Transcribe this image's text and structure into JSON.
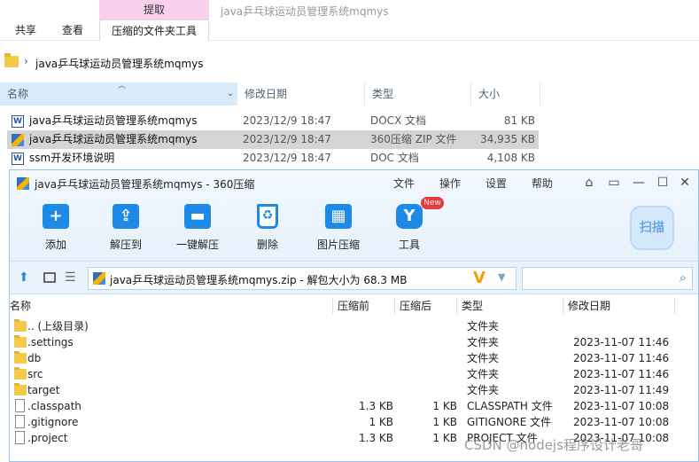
{
  "explorer": {
    "context_tab_header": "提取",
    "context_tab": "压缩的文件夹工具",
    "window_title": "java乒乓球运动员管理系统mqmys",
    "ribbon_tabs": [
      "共享",
      "查看"
    ],
    "address_path": "java乒乓球运动员管理系统mqmys",
    "columns": [
      "名称",
      "修改日期",
      "类型",
      "大小"
    ],
    "files": [
      {
        "name": "java乒乓球运动员管理系统mqmys",
        "date": "2023/12/9 18:47",
        "type": "DOCX 文档",
        "size": "81 KB",
        "icon": "word-doc-icon",
        "selected": false
      },
      {
        "name": "java乒乓球运动员管理系统mqmys",
        "date": "2023/12/9 18:47",
        "type": "360压缩 ZIP 文件",
        "size": "34,935 KB",
        "icon": "zip-archive-icon",
        "selected": true
      },
      {
        "name": "ssm开发环境说明",
        "date": "2023/12/9 18:47",
        "type": "DOC 文档",
        "size": "4,108 KB",
        "icon": "word-doc-icon",
        "selected": false
      }
    ]
  },
  "zip": {
    "title": "java乒乓球运动员管理系统mqmys - 360压缩",
    "menu": [
      "文件",
      "操作",
      "设置",
      "帮助"
    ],
    "toolbar": [
      {
        "label": "添加",
        "icon": "add-icon"
      },
      {
        "label": "解压到",
        "icon": "extract-to-icon"
      },
      {
        "label": "一键解压",
        "icon": "one-click-extract-icon"
      },
      {
        "label": "删除",
        "icon": "delete-icon"
      },
      {
        "label": "图片压缩",
        "icon": "image-compress-icon"
      },
      {
        "label": "工具",
        "icon": "tools-icon"
      }
    ],
    "new_badge": "New",
    "scan_label": "扫描",
    "path_text": "java乒乓球运动员管理系统mqmys.zip - 解包大小为 68.3 MB",
    "path_badge": "V",
    "columns": [
      "名称",
      "压缩前",
      "压缩后",
      "类型",
      "修改日期"
    ],
    "rows": [
      {
        "name": ".. (上级目录)",
        "before": "",
        "after": "",
        "type": "文件夹",
        "modified": "",
        "kind": "folder"
      },
      {
        "name": ".settings",
        "before": "",
        "after": "",
        "type": "文件夹",
        "modified": "2023-11-07 11:46",
        "kind": "folder"
      },
      {
        "name": "db",
        "before": "",
        "after": "",
        "type": "文件夹",
        "modified": "2023-11-07 11:46",
        "kind": "folder"
      },
      {
        "name": "src",
        "before": "",
        "after": "",
        "type": "文件夹",
        "modified": "2023-11-07 11:46",
        "kind": "folder"
      },
      {
        "name": "target",
        "before": "",
        "after": "",
        "type": "文件夹",
        "modified": "2023-11-07 11:49",
        "kind": "folder"
      },
      {
        "name": ".classpath",
        "before": "1.3 KB",
        "after": "1 KB",
        "type": "CLASSPATH 文件",
        "modified": "2023-11-07 10:08",
        "kind": "file"
      },
      {
        "name": ".gitignore",
        "before": "1 KB",
        "after": "1 KB",
        "type": "GITIGNORE 文件",
        "modified": "2023-11-07 10:08",
        "kind": "file"
      },
      {
        "name": ".project",
        "before": "1.3 KB",
        "after": "1 KB",
        "type": "PROJECT 文件",
        "modified": "2023-11-07 10:08",
        "kind": "file"
      }
    ]
  },
  "watermark": "CSDN @nodejs程序设计老哥",
  "colors": {
    "accent": "#1d8ae6",
    "context_tab": "#f9d1ef",
    "selection": "#d4d4d4",
    "folder": "#f3c948"
  }
}
